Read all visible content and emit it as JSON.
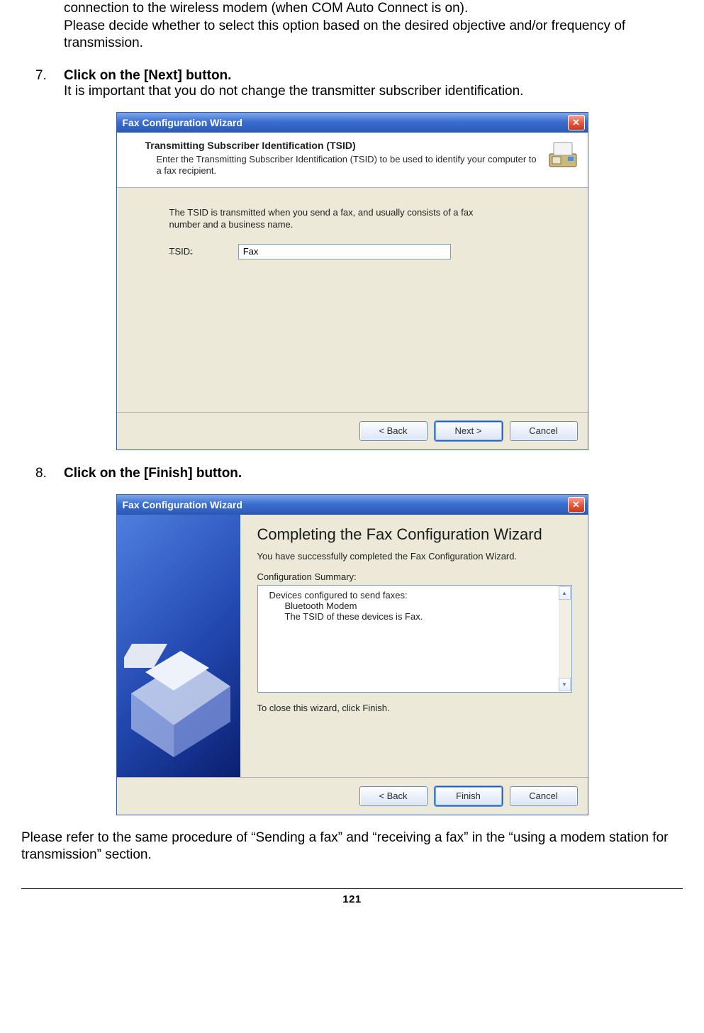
{
  "intro": {
    "line1": "connection to the wireless modem (when COM Auto Connect is on).",
    "line2": "Please decide whether to select this option based on the desired objective and/or frequency of transmission."
  },
  "step7": {
    "num": "7.",
    "title": "Click on the [Next] button.",
    "sub": "It is important that you do not change the transmitter subscriber identification."
  },
  "wiz1": {
    "titlebar": "Fax Configuration Wizard",
    "header_title": "Transmitting Subscriber Identification (TSID)",
    "header_desc": "Enter the Transmitting Subscriber Identification (TSID) to be used to identify your computer to a fax recipient.",
    "info": "The TSID is transmitted when you send a fax, and usually consists of a fax number and a business name.",
    "tsid_label": "TSID:",
    "tsid_value": "Fax",
    "btn_back": "< Back",
    "btn_next": "Next >",
    "btn_cancel": "Cancel"
  },
  "step8": {
    "num": "8.",
    "title": "Click on the [Finish] button."
  },
  "wiz2": {
    "titlebar": "Fax Configuration Wizard",
    "heading": "Completing the Fax Configuration Wizard",
    "sub": "You have successfully completed the Fax Configuration Wizard.",
    "summary_label": "Configuration Summary:",
    "summary_line1": "Devices configured to send faxes:",
    "summary_line2": "Bluetooth Modem",
    "summary_line3": "The TSID of these devices is Fax.",
    "close_hint": "To close this wizard, click Finish.",
    "btn_back": "< Back",
    "btn_finish": "Finish",
    "btn_cancel": "Cancel"
  },
  "outro": "Please refer to the same procedure of “Sending a fax” and “receiving a fax” in the “using a modem station for transmission” section.",
  "page_number": "121"
}
